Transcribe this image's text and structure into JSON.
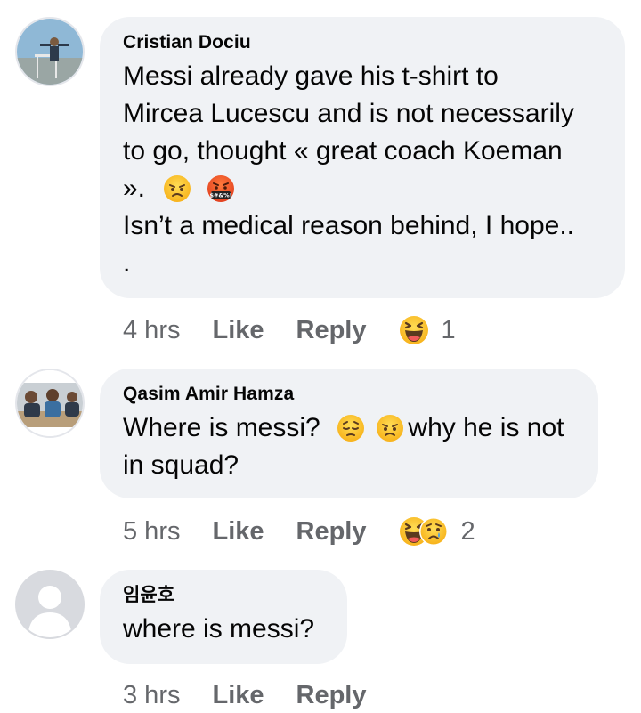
{
  "comments": [
    {
      "author": "Cristian Dociu",
      "lines": [
        "Messi already gave his t-shirt to",
        "Mircea Lucescu and is not necessarily",
        "to go, thought « great coach Koeman",
        "».",
        "Isn’t a medical reason behind, I hope..",
        "."
      ],
      "inline_emojis": [
        "angry-face",
        "cursing-face"
      ],
      "time": "4 hrs",
      "like_label": "Like",
      "reply_label": "Reply",
      "reactions": [
        "haha-reaction"
      ],
      "reaction_count": "1"
    },
    {
      "author": "Qasim Amir Hamza",
      "lines": [
        "Where is messi?",
        "why he is not",
        "in squad?"
      ],
      "inline_emojis": [
        "pensive-face",
        "angry-face"
      ],
      "time": "5 hrs",
      "like_label": "Like",
      "reply_label": "Reply",
      "reactions": [
        "haha-reaction",
        "sad-reaction"
      ],
      "reaction_count": "2"
    },
    {
      "author": "임윤호",
      "lines": [
        "where is messi?"
      ],
      "time": "3 hrs",
      "like_label": "Like",
      "reply_label": "Reply"
    }
  ],
  "colors": {
    "bubble": "#f0f2f5",
    "text": "#050505",
    "meta": "#65676b",
    "emoji_yellow": "#fcc21b",
    "emoji_red": "#f35d2b"
  }
}
